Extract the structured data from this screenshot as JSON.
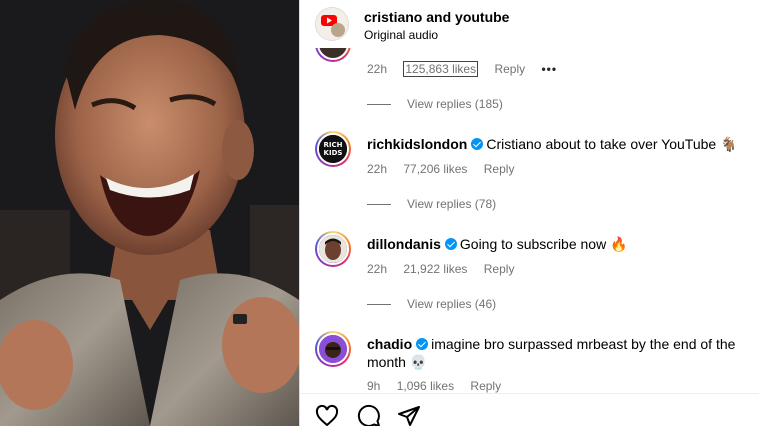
{
  "header": {
    "username": "cristiano",
    "title_suffix": " and youtube",
    "subtitle": "Original audio"
  },
  "first_comment": {
    "time": "22h",
    "likes": "125,863 likes",
    "reply": "Reply",
    "more": "•••",
    "view_replies": "View replies (185)"
  },
  "comments": [
    {
      "username": "richkidslondon",
      "text": "Cristiano about to take over YouTube 🐐",
      "time": "22h",
      "likes": "77,206 likes",
      "reply": "Reply",
      "view_replies": "View replies (78)"
    },
    {
      "username": "dillondanis",
      "text": "Going to subscribe now 🔥",
      "time": "22h",
      "likes": "21,922 likes",
      "reply": "Reply",
      "view_replies": "View replies (46)"
    },
    {
      "username": "chadio",
      "text": "imagine bro surpassed mrbeast by the end of the month 💀",
      "time": "9h",
      "likes": "1,096 likes",
      "reply": "Reply"
    }
  ],
  "icons": [
    "heart-icon",
    "comment-icon",
    "share-icon"
  ]
}
